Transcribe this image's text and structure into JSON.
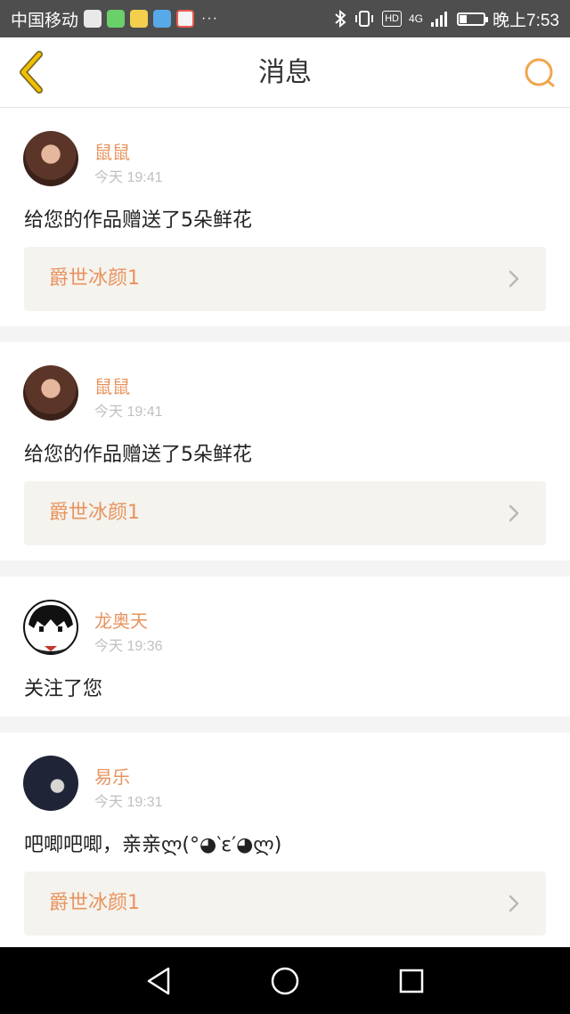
{
  "status_bar": {
    "carrier": "中国移动",
    "dots": "···",
    "hd": "HD",
    "network": "4G",
    "time": "晚上7:53"
  },
  "header": {
    "title": "消息"
  },
  "colors": {
    "accent": "#e8935e",
    "back_icon": "#f0c000",
    "search_icon": "#f0a64e"
  },
  "messages": [
    {
      "sender": "鼠鼠",
      "time": "今天 19:41",
      "content": "给您的作品赠送了5朵鲜花",
      "work_title": "爵世冰颜1",
      "avatar": "girl-avatar"
    },
    {
      "sender": "鼠鼠",
      "time": "今天 19:41",
      "content": "给您的作品赠送了5朵鲜花",
      "work_title": "爵世冰颜1",
      "avatar": "girl-avatar"
    },
    {
      "sender": "龙奥天",
      "time": "今天 19:36",
      "content": "关注了您",
      "avatar": "anime-avatar"
    },
    {
      "sender": "易乐",
      "time": "今天 19:31",
      "content": "吧唧吧唧，亲亲ლ(°◕‵ε′◕ლ)",
      "work_title": "爵世冰颜1",
      "avatar": "dark-avatar"
    }
  ]
}
